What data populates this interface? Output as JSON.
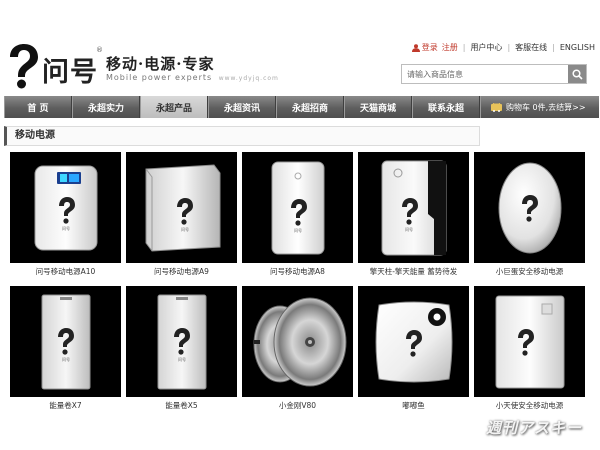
{
  "header": {
    "brand_name": "问号",
    "registered": "®",
    "slogan": "移动·电源·专家",
    "slogan_en": "Mobile power experts",
    "slogan_url": "www.ydyjq.com",
    "login": "登录",
    "register": "注册",
    "user_center": "用户中心",
    "support": "客服在线",
    "english": "ENGLISH"
  },
  "search": {
    "placeholder": "请输入商品信息"
  },
  "nav": {
    "items": [
      {
        "label": "首 页",
        "active": false
      },
      {
        "label": "永超实力",
        "active": false
      },
      {
        "label": "永超产品",
        "active": true
      },
      {
        "label": "永超资讯",
        "active": false
      },
      {
        "label": "永超招商",
        "active": false
      },
      {
        "label": "天猫商城",
        "active": false
      },
      {
        "label": "联系永超",
        "active": false
      }
    ],
    "cart_text": "购物车 0件,去结算>>"
  },
  "section": {
    "title": "移动电源"
  },
  "products": [
    {
      "name": "问号移动电源A10",
      "icon": "power-bank-with-display"
    },
    {
      "name": "问号移动电源A9",
      "icon": "power-bank-box"
    },
    {
      "name": "问号移动电源A8",
      "icon": "power-bank-slim"
    },
    {
      "name": "擎天柱-擎天能量 蓄势待发",
      "icon": "power-bank-stripe"
    },
    {
      "name": "小巨蛋安全移动电源",
      "icon": "power-bank-egg"
    },
    {
      "name": "能量卷X7",
      "icon": "power-bank-tall"
    },
    {
      "name": "能量卷X5",
      "icon": "power-bank-tall"
    },
    {
      "name": "小金刚V80",
      "icon": "power-bank-disc"
    },
    {
      "name": "嘟嘟鱼",
      "icon": "power-bank-square"
    },
    {
      "name": "小天使安全移动电源",
      "icon": "power-bank-angel"
    }
  ],
  "watermark": "週刊アスキー",
  "colors": {
    "nav_dark": "#5e5e5e",
    "nav_active": "#c8c8c8",
    "link_red": "#c0392b",
    "product_bg": "#000000"
  }
}
